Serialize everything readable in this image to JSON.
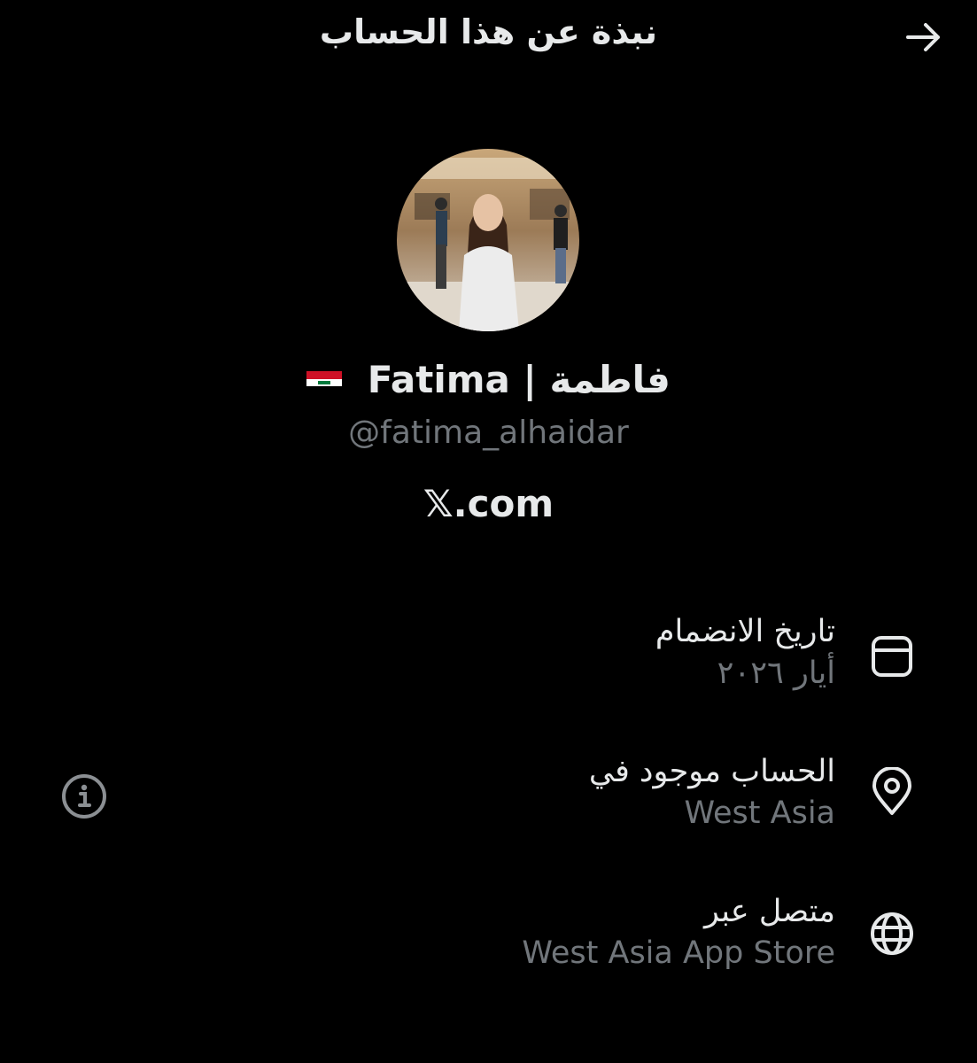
{
  "header": {
    "title": "نبذة عن هذا الحساب",
    "back_icon": "arrow-right-icon"
  },
  "profile": {
    "avatar_icon": "profile-photo",
    "display_name": "فاطمة | Fatima",
    "flag_icon": "iraq-flag-icon",
    "username": "@fatima_alhaidar",
    "site": "𝕏.com"
  },
  "rows": [
    {
      "icon": "calendar-icon",
      "label": "تاريخ الانضمام",
      "value": "أيار ٢٠٢٦"
    },
    {
      "icon": "location-pin-icon",
      "label": "الحساب موجود في",
      "value": "West Asia"
    },
    {
      "icon": "globe-icon",
      "label": "متصل عبر",
      "value": "West Asia App Store"
    }
  ],
  "info_icon": "info-icon",
  "colors": {
    "background": "#000000",
    "primary_text": "#e7e9ea",
    "secondary_text": "#71767b"
  }
}
